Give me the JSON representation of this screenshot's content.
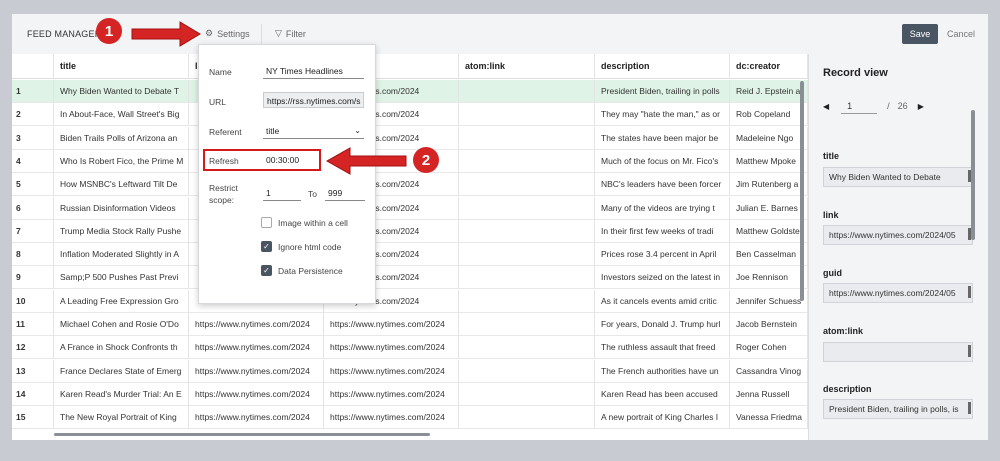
{
  "toolbar": {
    "app_title": "FEED MANAGER",
    "settings_label": "Settings",
    "filter_label": "Filter",
    "save_label": "Save",
    "cancel_label": "Cancel"
  },
  "grid": {
    "columns": [
      "",
      "title",
      "link",
      "",
      "atom:link",
      "description",
      "dc:creator"
    ],
    "rows": [
      {
        "n": "1",
        "title": "Why Biden Wanted to Debate T",
        "link": "",
        "guid": "www.nytimes.com/2024",
        "desc": "President Biden, trailing in polls",
        "creator": "Reid J. Epstein a"
      },
      {
        "n": "2",
        "title": "In About-Face, Wall Street's Big",
        "link": "",
        "guid": "www.nytimes.com/2024",
        "desc": "They may \"hate the man,\" as or",
        "creator": "Rob Copeland"
      },
      {
        "n": "3",
        "title": "Biden Trails Polls of Arizona an",
        "link": "",
        "guid": "www.nytimes.com/2024",
        "desc": "The states have been major be",
        "creator": "Madeleine Ngo"
      },
      {
        "n": "4",
        "title": "Who Is Robert Fico, the Prime M",
        "link": "",
        "guid": "es.com/2024",
        "desc": "Much of the focus on Mr. Fico's",
        "creator": "Matthew Mpoke"
      },
      {
        "n": "5",
        "title": "How MSNBC's Leftward Tilt De",
        "link": "",
        "guid": "www.nytimes.com/2024",
        "desc": "NBC's leaders have been forcer",
        "creator": "Jim Rutenberg a"
      },
      {
        "n": "6",
        "title": "Russian Disinformation Videos",
        "link": "",
        "guid": "www.nytimes.com/2024",
        "desc": "Many of the videos are trying t",
        "creator": "Julian E. Barnes"
      },
      {
        "n": "7",
        "title": "Trump Media Stock Rally Pushe",
        "link": "",
        "guid": "www.nytimes.com/2024",
        "desc": "In their first few weeks of tradi",
        "creator": "Matthew Goldste"
      },
      {
        "n": "8",
        "title": "Inflation Moderated Slightly in A",
        "link": "",
        "guid": "www.nytimes.com/2024",
        "desc": "Prices rose 3.4 percent in April",
        "creator": "Ben Casselman"
      },
      {
        "n": "9",
        "title": "Samp;P 500 Pushes Past Previ",
        "link": "",
        "guid": "www.nytimes.com/2024",
        "desc": "Investors seized on the latest in",
        "creator": "Joe Rennison"
      },
      {
        "n": "10",
        "title": "A Leading Free Expression Gro",
        "link": "",
        "guid": "www.nytimes.com/2024",
        "desc": "As it cancels events amid critic",
        "creator": "Jennifer Schuess"
      },
      {
        "n": "11",
        "title": "Michael Cohen and Rosie O'Do",
        "link": "https://www.nytimes.com/2024",
        "guid": "https://www.nytimes.com/2024",
        "desc": "For years, Donald J. Trump hurl",
        "creator": "Jacob Bernstein"
      },
      {
        "n": "12",
        "title": "A France in Shock Confronts th",
        "link": "https://www.nytimes.com/2024",
        "guid": "https://www.nytimes.com/2024",
        "desc": "The ruthless assault that freed",
        "creator": "Roger Cohen"
      },
      {
        "n": "13",
        "title": "France Declares State of Emerg",
        "link": "https://www.nytimes.com/2024",
        "guid": "https://www.nytimes.com/2024",
        "desc": "The French authorities have un",
        "creator": "Cassandra Vinog"
      },
      {
        "n": "14",
        "title": "Karen Read's Murder Trial: An E",
        "link": "https://www.nytimes.com/2024",
        "guid": "https://www.nytimes.com/2024",
        "desc": "Karen Read has been accused",
        "creator": "Jenna Russell"
      },
      {
        "n": "15",
        "title": "The New Royal Portrait of King",
        "link": "https://www.nytimes.com/2024",
        "guid": "https://www.nytimes.com/2024",
        "desc": "A new portrait of King Charles I",
        "creator": "Vanessa Friedma"
      }
    ]
  },
  "record_view": {
    "title": "Record view",
    "page": "1",
    "separator": "/",
    "total": "26",
    "fields": [
      {
        "label": "title",
        "value": "Why Biden Wanted to Debate"
      },
      {
        "label": "link",
        "value": "https://www.nytimes.com/2024/05"
      },
      {
        "label": "guid",
        "value": "https://www.nytimes.com/2024/05"
      },
      {
        "label": "atom:link",
        "value": ""
      },
      {
        "label": "description",
        "value": "President Biden, trailing in polls, is"
      }
    ]
  },
  "settings_popup": {
    "name_label": "Name",
    "name_value": "NY Times Headlines",
    "url_label": "URL",
    "url_value": "https://rss.nytimes.com/s",
    "referent_label": "Referent",
    "referent_value": "title",
    "refresh_label": "Refresh",
    "refresh_value": "00:30:00",
    "scope_label": "Restrict scope:",
    "scope_from": "1",
    "scope_to_label": "To",
    "scope_to": "999",
    "image_cell_label": "Image within a cell",
    "ignore_html_label": "Ignore html code",
    "persistence_label": "Data Persistence"
  },
  "annotations": {
    "badge1": "1",
    "badge2": "2",
    "color": "#d42424"
  }
}
